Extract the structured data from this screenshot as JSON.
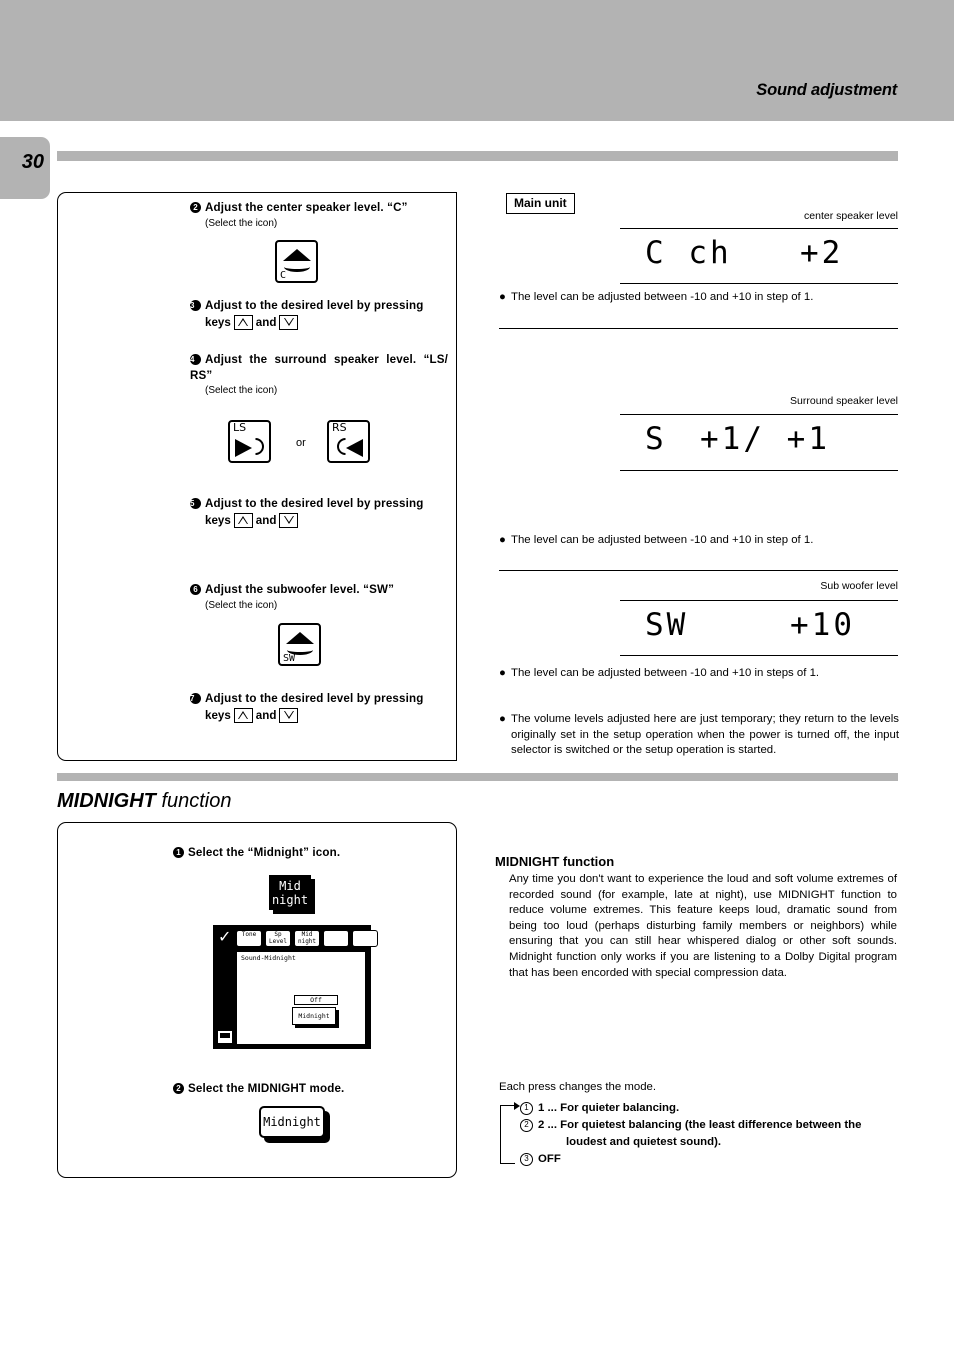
{
  "header": {
    "title": "Sound adjustment",
    "page_number": "30"
  },
  "left_panel": {
    "steps": [
      {
        "num": "2",
        "heading": "Adjust the center speaker level. “C”",
        "note": "(Select the icon)",
        "icon_label": "C"
      },
      {
        "num": "3",
        "heading": "Adjust to the desired level by pressing",
        "keys_prefix": "keys",
        "keys_and": "and"
      },
      {
        "num": "4",
        "heading": "Adjust the surround speaker level. “LS/ RS”",
        "note": "(Select the icon)",
        "icon_label_left": "LS",
        "icon_label_right": "RS",
        "or_label": "or"
      },
      {
        "num": "5",
        "heading": "Adjust to the desired level by pressing",
        "keys_prefix": "keys",
        "keys_and": "and"
      },
      {
        "num": "6",
        "heading": "Adjust the subwoofer level. “SW”",
        "note": "(Select the icon)",
        "icon_label": "SW"
      },
      {
        "num": "7",
        "heading": "Adjust to the desired level by pressing",
        "keys_prefix": "keys",
        "keys_and": "and"
      }
    ]
  },
  "right_panel": {
    "main_unit_label": "Main unit",
    "displays": [
      {
        "caption": "center speaker level",
        "lcd_left": "C ch",
        "lcd_right": "+2"
      },
      {
        "caption": "Surround speaker level",
        "lcd_left": "S",
        "lcd_right": "+1/ +1"
      },
      {
        "caption": "Sub woofer level",
        "lcd_left": "SW",
        "lcd_right": "+10"
      }
    ],
    "bullets": [
      "The level can be adjusted between -10 and +10 in step of 1.",
      "The level can be adjusted between -10 and +10 in step of 1.",
      "The level can be adjusted between -10 and +10 in steps of 1.",
      "The volume levels adjusted here are just temporary; they return to the levels originally set in the setup operation when the power is turned off, the input selector is switched or the setup operation is started."
    ]
  },
  "midnight_section": {
    "title_bold": "MIDNIGHT",
    "title_thin": " function",
    "steps": [
      {
        "num": "1",
        "heading": "Select the “Midnight” icon."
      },
      {
        "num": "2",
        "heading": "Select the MIDNIGHT mode."
      }
    ],
    "midnight_icon": {
      "line1": "Mid",
      "line2": "night"
    },
    "screen": {
      "tabs": [
        {
          "line1": "Tone",
          "line2": ""
        },
        {
          "line1": "Sp",
          "line2": "Level"
        },
        {
          "line1": "Mid",
          "line2": "night"
        },
        {
          "line1": "",
          "line2": ""
        },
        {
          "line1": "",
          "line2": ""
        }
      ],
      "body_title": "Sound-Midnight",
      "off_chip": "Off",
      "mid_chip": "Midnight"
    },
    "midnight_button": "Midnight",
    "description": {
      "heading": "MIDNIGHT function",
      "body": "Any time you don't want to experience the loud and soft volume extremes of recorded sound (for example, late at night), use MIDNIGHT function to reduce volume extremes.  This feature keeps loud, dramatic sound from being too loud (perhaps disturbing family members or neighbors) while ensuring that you can still hear whispered dialog or other soft sounds. Midnight function only works if you are listening to a Dolby Digital program that has been encorded with special compression data."
    },
    "each_press": "Each press changes the mode.",
    "modes": [
      {
        "circ": "1",
        "text": "1 ... For quieter balancing.",
        "cont": ""
      },
      {
        "circ": "2",
        "text": "2 ... For quietest balancing (the least difference between the",
        "cont": "loudest and quietest sound)."
      },
      {
        "circ": "3",
        "text": "OFF",
        "cont": ""
      }
    ]
  }
}
